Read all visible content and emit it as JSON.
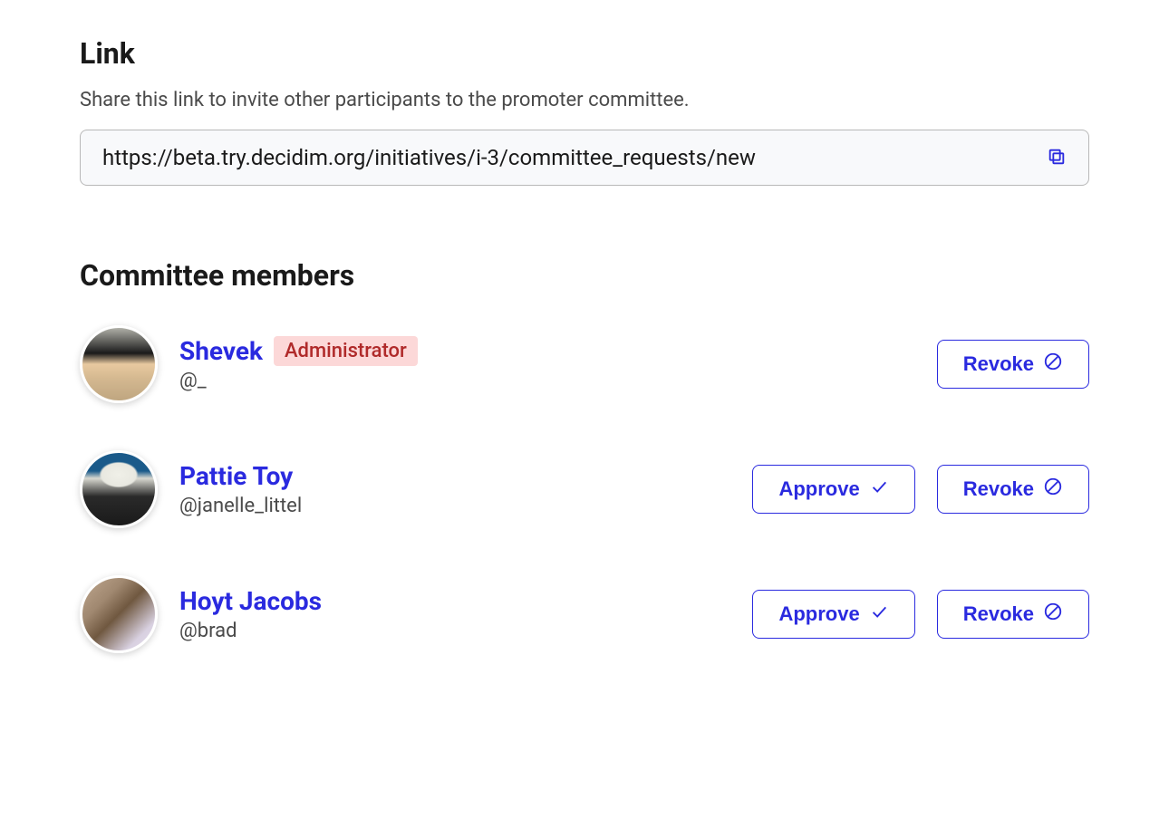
{
  "link_section": {
    "title": "Link",
    "description": "Share this link to invite other participants to the promoter committee.",
    "url": "https://beta.try.decidim.org/initiatives/i-3/committee_requests/new"
  },
  "members_section": {
    "title": "Committee members"
  },
  "labels": {
    "approve": "Approve",
    "revoke": "Revoke"
  },
  "members": [
    {
      "name": "Shevek",
      "handle": "@_",
      "badge": "Administrator",
      "can_approve": false,
      "can_revoke": true
    },
    {
      "name": "Pattie Toy",
      "handle": "@janelle_littel",
      "badge": null,
      "can_approve": true,
      "can_revoke": true
    },
    {
      "name": "Hoyt Jacobs",
      "handle": "@brad",
      "badge": null,
      "can_approve": true,
      "can_revoke": true
    }
  ]
}
